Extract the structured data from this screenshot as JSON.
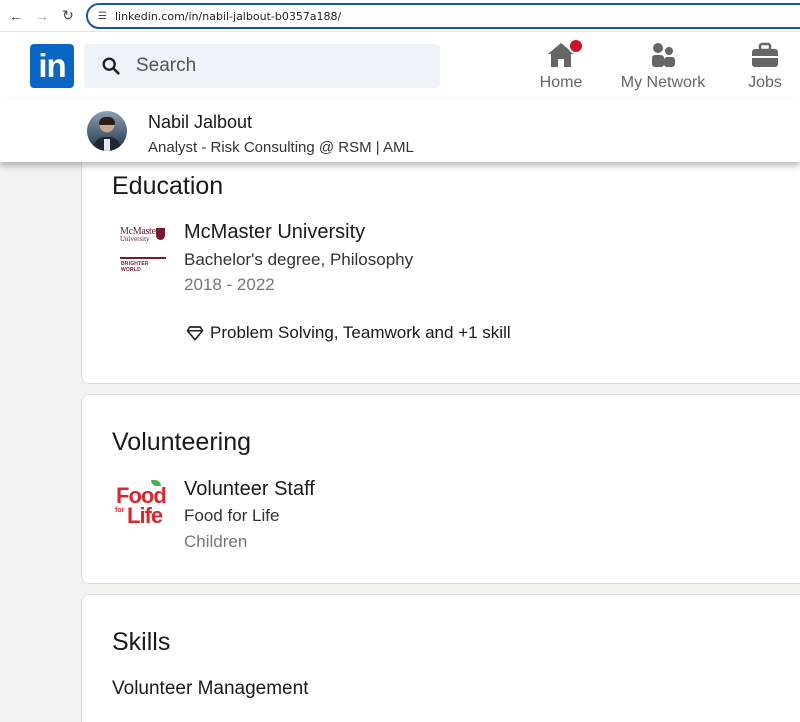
{
  "browser": {
    "url": "linkedin.com/in/nabil-jalbout-b0357a188/"
  },
  "header": {
    "logo_text": "in",
    "search_placeholder": "Search",
    "nav": [
      {
        "label": "Home",
        "icon": "home-icon",
        "has_notification": true
      },
      {
        "label": "My Network",
        "icon": "people-icon"
      },
      {
        "label": "Jobs",
        "icon": "briefcase-icon"
      }
    ]
  },
  "profile": {
    "name": "Nabil Jalbout",
    "headline": "Analyst - Risk Consulting @ RSM | AML"
  },
  "education": {
    "title": "Education",
    "entries": [
      {
        "school": "McMaster University",
        "degree": "Bachelor's degree, Philosophy",
        "dates": "2018 - 2022",
        "skills": "Problem Solving, Teamwork and +1 skill",
        "logo_text": {
          "line1": "McMaster",
          "line2": "University",
          "tag": "BRIGHTER WORLD"
        }
      }
    ]
  },
  "volunteering": {
    "title": "Volunteering",
    "entries": [
      {
        "role": "Volunteer Staff",
        "organization": "Food for Life",
        "cause": "Children",
        "logo_text": {
          "food": "Food",
          "for": "for",
          "life": "Life"
        }
      }
    ]
  },
  "skills": {
    "title": "Skills",
    "items": [
      {
        "name": "Volunteer Management"
      }
    ]
  },
  "colors": {
    "brand_blue": "#0a66c2",
    "notification_red": "#cb112d",
    "mcmaster_maroon": "#7a1a30",
    "food_for_life_red": "#d7282f"
  }
}
